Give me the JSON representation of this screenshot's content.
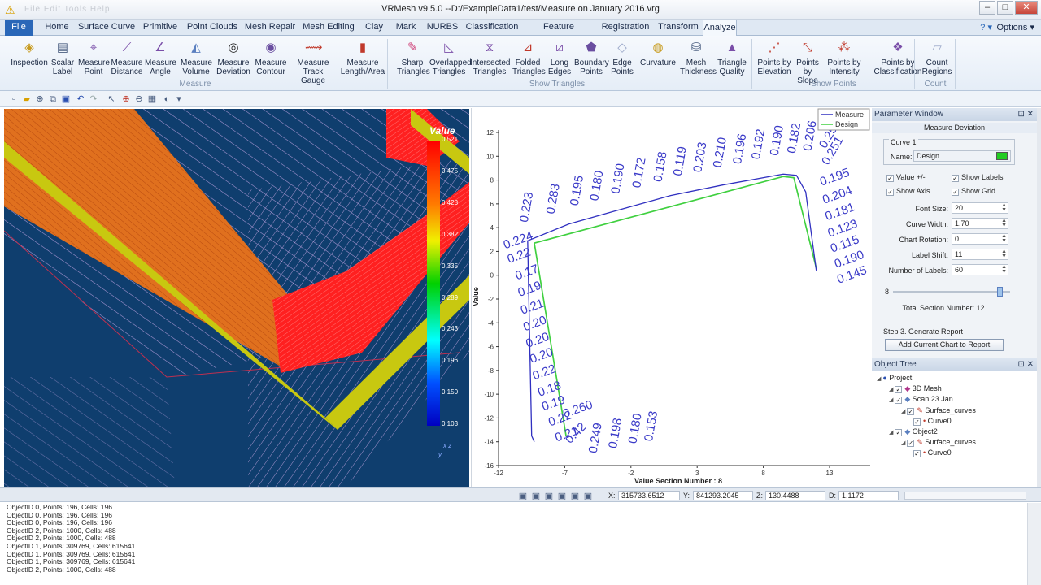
{
  "window": {
    "title": "VRMesh v9.5.0 --D:/ExampleData1/test/Measure on January 2016.vrg",
    "ghost_menu": "File  Edit  Tools  Help",
    "min": "–",
    "max": "□",
    "close": "✕"
  },
  "ribbon_tabs": [
    "File",
    "Home",
    "Surface Curve",
    "Primitive",
    "Point Clouds",
    "Mesh Repair",
    "Mesh Editing",
    "Clay",
    "Mark",
    "NURBS",
    "Classification",
    "Feature Extraction",
    "Registration",
    "Transform",
    "Analyze"
  ],
  "help_label": "?",
  "options_label": "Options",
  "ribbon_buttons": [
    {
      "l1": "Inspection",
      "l2": "",
      "icon": "inspection-icon",
      "glyph": "◈",
      "color": "#c79a1c"
    },
    {
      "l1": "Scalar",
      "l2": "Label",
      "icon": "scalar-label-icon",
      "glyph": "▤",
      "color": "#4a5e80"
    },
    {
      "l1": "Measure",
      "l2": "Point",
      "icon": "measure-point-icon",
      "glyph": "⌖",
      "color": "#7a4ea8"
    },
    {
      "l1": "Measure",
      "l2": "Distance",
      "icon": "measure-distance-icon",
      "glyph": "⟋",
      "color": "#7a4ea8"
    },
    {
      "l1": "Measure",
      "l2": "Angle",
      "icon": "measure-angle-icon",
      "glyph": "∠",
      "color": "#7a4ea8"
    },
    {
      "l1": "Measure",
      "l2": "Volume",
      "icon": "measure-volume-icon",
      "glyph": "◭",
      "color": "#5a7fc0"
    },
    {
      "l1": "Measure",
      "l2": "Deviation",
      "icon": "measure-deviation-icon",
      "glyph": "◎",
      "color": "#222"
    },
    {
      "l1": "Measure",
      "l2": "Contour",
      "icon": "measure-contour-icon",
      "glyph": "◉",
      "color": "#6a4ea0"
    },
    {
      "l1": "Measure Track",
      "l2": "Gauge",
      "icon": "track-gauge-icon",
      "glyph": "⟿",
      "color": "#c0392b"
    },
    {
      "l1": "Measure",
      "l2": "Length/Area",
      "icon": "length-area-icon",
      "glyph": "▮",
      "color": "#c0392b"
    },
    {
      "l1": "Sharp",
      "l2": "Triangles",
      "icon": "sharp-triangles-icon",
      "glyph": "✎",
      "color": "#d0457a"
    },
    {
      "l1": "Overlapped",
      "l2": "Triangles",
      "icon": "overlapped-triangles-icon",
      "glyph": "◺",
      "color": "#7a4ea8"
    },
    {
      "l1": "Intersected",
      "l2": "Triangles",
      "icon": "intersected-triangles-icon",
      "glyph": "⧖",
      "color": "#7a4ea8"
    },
    {
      "l1": "Folded",
      "l2": "Triangles",
      "icon": "folded-triangles-icon",
      "glyph": "⊿",
      "color": "#c0392b"
    },
    {
      "l1": "Long",
      "l2": "Edges",
      "icon": "long-edges-icon",
      "glyph": "⧄",
      "color": "#7a4ea8"
    },
    {
      "l1": "Boundary",
      "l2": "Points",
      "icon": "boundary-points-icon",
      "glyph": "⬟",
      "color": "#6a4ea0"
    },
    {
      "l1": "Edge",
      "l2": "Points",
      "icon": "edge-points-icon",
      "glyph": "◇",
      "color": "#9aa7c8"
    },
    {
      "l1": "Curvature",
      "l2": "",
      "icon": "curvature-icon",
      "glyph": "◍",
      "color": "#c79a1c"
    },
    {
      "l1": "Mesh",
      "l2": "Thickness",
      "icon": "mesh-thickness-icon",
      "glyph": "⛁",
      "color": "#4a5e80"
    },
    {
      "l1": "Triangle",
      "l2": "Quality",
      "icon": "triangle-quality-icon",
      "glyph": "▲",
      "color": "#7a4ea8"
    },
    {
      "l1": "Points by",
      "l2": "Elevation",
      "icon": "points-elevation-icon",
      "glyph": "⋰",
      "color": "#c0392b"
    },
    {
      "l1": "Points by",
      "l2": "Slope",
      "icon": "points-slope-icon",
      "glyph": "⤡",
      "color": "#c0392b"
    },
    {
      "l1": "Points by",
      "l2": "Intensity",
      "icon": "points-intensity-icon",
      "glyph": "⁂",
      "color": "#c0392b"
    },
    {
      "l1": "Points by",
      "l2": "Classification",
      "icon": "points-classification-icon",
      "glyph": "❖",
      "color": "#7a4ea8"
    },
    {
      "l1": "Count",
      "l2": "Regions",
      "icon": "count-regions-icon",
      "glyph": "▱",
      "color": "#9aa7c8"
    }
  ],
  "ribbon_groups": [
    "Measure",
    "Show Triangles",
    "Show Points",
    "Count"
  ],
  "scale_bar": {
    "title": "Value",
    "ticks": [
      "0.521",
      "0.475",
      "0.428",
      "0.382",
      "0.335",
      "0.289",
      "0.243",
      "0.196",
      "0.150",
      "0.103"
    ],
    "axes": "x z",
    "axis_y": "y"
  },
  "chart_data": {
    "type": "line",
    "legend": [
      "Measure",
      "Design"
    ],
    "series_colors": [
      "#3030c0",
      "#40d040"
    ],
    "xlabel": "Value    Section Number : 8",
    "ylabel": "Value",
    "xlim": [
      -12,
      13
    ],
    "ylim": [
      -16,
      12
    ],
    "x_ticks": [
      "-12",
      "-7",
      "-2",
      "3",
      "8",
      "13"
    ],
    "y_ticks": [
      "12",
      "10",
      "8",
      "6",
      "4",
      "2",
      "0",
      "-2",
      "-4",
      "-6",
      "-8",
      "-10",
      "-12",
      "-14",
      "-16"
    ],
    "polyline": [
      [
        -9.3,
        -14.0
      ],
      [
        -9.5,
        -13.5
      ],
      [
        -9.8,
        2.9
      ],
      [
        -6.7,
        4.3
      ],
      [
        -3.2,
        5.4
      ],
      [
        1.0,
        6.7
      ],
      [
        5.0,
        7.6
      ],
      [
        9.5,
        8.5
      ],
      [
        10.5,
        8.4
      ],
      [
        11.2,
        7.0
      ],
      [
        12.0,
        0.4
      ]
    ],
    "polyline2": [
      [
        -6.9,
        -13.5
      ],
      [
        -9.3,
        2.7
      ],
      [
        9.5,
        8.3
      ],
      [
        10.3,
        8.2
      ],
      [
        12.0,
        0.6
      ]
    ],
    "labels": [
      {
        "t": "0.224",
        "x": -11.5,
        "y": 2.2,
        "r": -20
      },
      {
        "t": "0.22",
        "x": -11.2,
        "y": 1.0,
        "r": -20
      },
      {
        "t": "0.17",
        "x": -10.6,
        "y": -0.4,
        "r": -20
      },
      {
        "t": "0.19",
        "x": -10.4,
        "y": -1.8,
        "r": -20
      },
      {
        "t": "0.21",
        "x": -10.2,
        "y": -3.3,
        "r": -20
      },
      {
        "t": "0.20",
        "x": -10.0,
        "y": -4.7,
        "r": -20
      },
      {
        "t": "0.20",
        "x": -9.8,
        "y": -6.1,
        "r": -20
      },
      {
        "t": "0.20",
        "x": -9.5,
        "y": -7.4,
        "r": -20
      },
      {
        "t": "0.22",
        "x": -9.3,
        "y": -8.8,
        "r": -20
      },
      {
        "t": "0.18",
        "x": -8.9,
        "y": -10.2,
        "r": -20
      },
      {
        "t": "0.19",
        "x": -8.6,
        "y": -11.4,
        "r": -20
      },
      {
        "t": "0.22",
        "x": -8.1,
        "y": -12.7,
        "r": -20
      },
      {
        "t": "0.21",
        "x": -7.6,
        "y": -14.0,
        "r": -20
      },
      {
        "t": "0.260",
        "x": -7.0,
        "y": -12.0,
        "r": -20
      },
      {
        "t": "0.42",
        "x": -6.6,
        "y": -14.2,
        "r": -45
      },
      {
        "t": "0.249",
        "x": -4.6,
        "y": -15.0,
        "r": -80
      },
      {
        "t": "0.198",
        "x": -3.1,
        "y": -14.6,
        "r": -80
      },
      {
        "t": "0.180",
        "x": -1.6,
        "y": -14.2,
        "r": -80
      },
      {
        "t": "0.153",
        "x": -0.4,
        "y": -14.0,
        "r": -80
      },
      {
        "t": "0.223",
        "x": -9.8,
        "y": 4.4,
        "r": -80
      },
      {
        "t": "0.283",
        "x": -7.8,
        "y": 5.1,
        "r": -80
      },
      {
        "t": "0.195",
        "x": -6.0,
        "y": 5.8,
        "r": -80
      },
      {
        "t": "0.180",
        "x": -4.5,
        "y": 6.2,
        "r": -80
      },
      {
        "t": "0.190",
        "x": -2.9,
        "y": 6.8,
        "r": -80
      },
      {
        "t": "0.172",
        "x": -1.3,
        "y": 7.3,
        "r": -80
      },
      {
        "t": "0.158",
        "x": 0.3,
        "y": 7.8,
        "r": -80
      },
      {
        "t": "0.119",
        "x": 1.8,
        "y": 8.3,
        "r": -80
      },
      {
        "t": "0.203",
        "x": 3.3,
        "y": 8.6,
        "r": -80
      },
      {
        "t": "0.210",
        "x": 4.8,
        "y": 9.0,
        "r": -80
      },
      {
        "t": "0.196",
        "x": 6.3,
        "y": 9.3,
        "r": -80
      },
      {
        "t": "0.192",
        "x": 7.7,
        "y": 9.7,
        "r": -80
      },
      {
        "t": "0.190",
        "x": 9.1,
        "y": 10.0,
        "r": -80
      },
      {
        "t": "0.182",
        "x": 10.4,
        "y": 10.2,
        "r": -80
      },
      {
        "t": "0.206",
        "x": 11.6,
        "y": 10.4,
        "r": -80
      },
      {
        "t": "0.254",
        "x": 12.7,
        "y": 10.6,
        "r": -60
      },
      {
        "t": "0.251",
        "x": 12.9,
        "y": 9.2,
        "r": -60
      },
      {
        "t": "0.195",
        "x": 12.4,
        "y": 7.5,
        "r": -20
      },
      {
        "t": "0.204",
        "x": 12.6,
        "y": 6.0,
        "r": -20
      },
      {
        "t": "0.181",
        "x": 12.8,
        "y": 4.6,
        "r": -20
      },
      {
        "t": "0.123",
        "x": 13.0,
        "y": 3.2,
        "r": -20
      },
      {
        "t": "0.115",
        "x": 13.2,
        "y": 1.9,
        "r": -20
      },
      {
        "t": "0.190",
        "x": 13.5,
        "y": 0.6,
        "r": -20
      },
      {
        "t": "0.145",
        "x": 13.7,
        "y": -0.7,
        "r": -20
      }
    ]
  },
  "param_window": {
    "title": "Parameter Window",
    "subtitle": "Measure Deviation",
    "curve_group": "Curve 1",
    "name_label": "Name:",
    "name_value": "Design",
    "value_pm": "Value +/-",
    "show_labels": "Show Labels",
    "show_axis": "Show Axis",
    "show_grid": "Show Grid",
    "font_size_label": "Font Size:",
    "font_size": "20",
    "curve_width_label": "Curve Width:",
    "curve_width": "1.70",
    "rotation_label": "Chart Rotation:",
    "rotation": "0",
    "shift_label": "Label Shift:",
    "shift": "11",
    "nlabels_label": "Number of Labels:",
    "nlabels": "60",
    "slider_value": "8",
    "slider_fraction": 0.92,
    "total_sections": "Total Section Number:  12",
    "step3": "Step 3. Generate  Report",
    "add_report": "Add Current Chart to Report",
    "name_color": "#22cc22"
  },
  "object_tree": {
    "title": "Object Tree",
    "nodes": [
      {
        "label": "Project",
        "lvl": 0,
        "check": false,
        "icon": "●",
        "ic": "#2a4fb0"
      },
      {
        "label": "3D Mesh",
        "lvl": 1,
        "check": true,
        "icon": "◆",
        "ic": "#b0358a"
      },
      {
        "label": "Scan 23 Jan",
        "lvl": 1,
        "check": true,
        "icon": "◆",
        "ic": "#5a7fc0"
      },
      {
        "label": "Surface_curves",
        "lvl": 2,
        "check": true,
        "icon": "✎",
        "ic": "#c0392b"
      },
      {
        "label": "Curve0",
        "lvl": 3,
        "check": true,
        "icon": "•",
        "ic": "#c0392b"
      },
      {
        "label": "Object2",
        "lvl": 1,
        "check": true,
        "icon": "◆",
        "ic": "#5a7fc0"
      },
      {
        "label": "Surface_curves",
        "lvl": 2,
        "check": true,
        "icon": "✎",
        "ic": "#c0392b"
      },
      {
        "label": "Curve0",
        "lvl": 3,
        "check": true,
        "icon": "•",
        "ic": "#c0392b"
      }
    ]
  },
  "status": {
    "x_label": "X:",
    "x": "315733.6512",
    "y_label": "Y:",
    "y": "841293.2045",
    "z_label": "Z:",
    "z": "130.4488",
    "d_label": "D:",
    "d": "1.1172"
  },
  "log_lines": [
    "ObjectID 0, Points: 196, Cells: 196",
    "ObjectID 0, Points: 196, Cells: 196",
    "ObjectID 0, Points: 196, Cells: 196",
    "ObjectID 2, Points: 1000, Cells: 488",
    "ObjectID 2, Points: 1000, Cells: 488",
    "ObjectID 1, Points: 309769, Cells: 615641",
    "ObjectID 1, Points: 309769, Cells: 615641",
    "ObjectID 1, Points: 309769, Cells: 615641",
    "ObjectID 2, Points: 1000, Cells: 488"
  ]
}
